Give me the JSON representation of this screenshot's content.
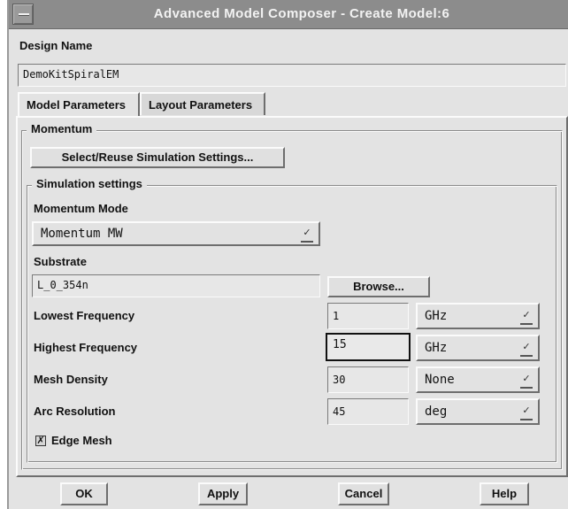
{
  "window": {
    "title": "Advanced Model Composer - Create Model:6"
  },
  "design": {
    "label": "Design Name",
    "value": "DemoKitSpiralEM"
  },
  "tabs": [
    {
      "label": "Model Parameters",
      "active": true
    },
    {
      "label": "Layout Parameters",
      "active": false
    }
  ],
  "momentum": {
    "group_label": "Momentum",
    "select_button": "Select/Reuse Simulation Settings..."
  },
  "simulation": {
    "group_label": "Simulation settings",
    "mode_label": "Momentum Mode",
    "mode_value": "Momentum MW",
    "substrate_label": "Substrate",
    "substrate_value": "L_0_354n",
    "browse_button": "Browse...",
    "lowest_freq_label": "Lowest Frequency",
    "lowest_freq_value": "1",
    "lowest_freq_unit": "GHz",
    "highest_freq_label": "Highest Frequency",
    "highest_freq_value": "15",
    "highest_freq_unit": "GHz",
    "mesh_density_label": "Mesh Density",
    "mesh_density_value": "30",
    "mesh_density_unit": "None",
    "arc_resolution_label": "Arc Resolution",
    "arc_resolution_value": "45",
    "arc_resolution_unit": "deg",
    "edge_mesh_label": "Edge Mesh",
    "edge_mesh_checked": true
  },
  "buttons": {
    "ok": "OK",
    "apply": "Apply",
    "cancel": "Cancel",
    "help": "Help"
  },
  "icons": {
    "checkmark": "✗",
    "dropdown": "✓"
  }
}
